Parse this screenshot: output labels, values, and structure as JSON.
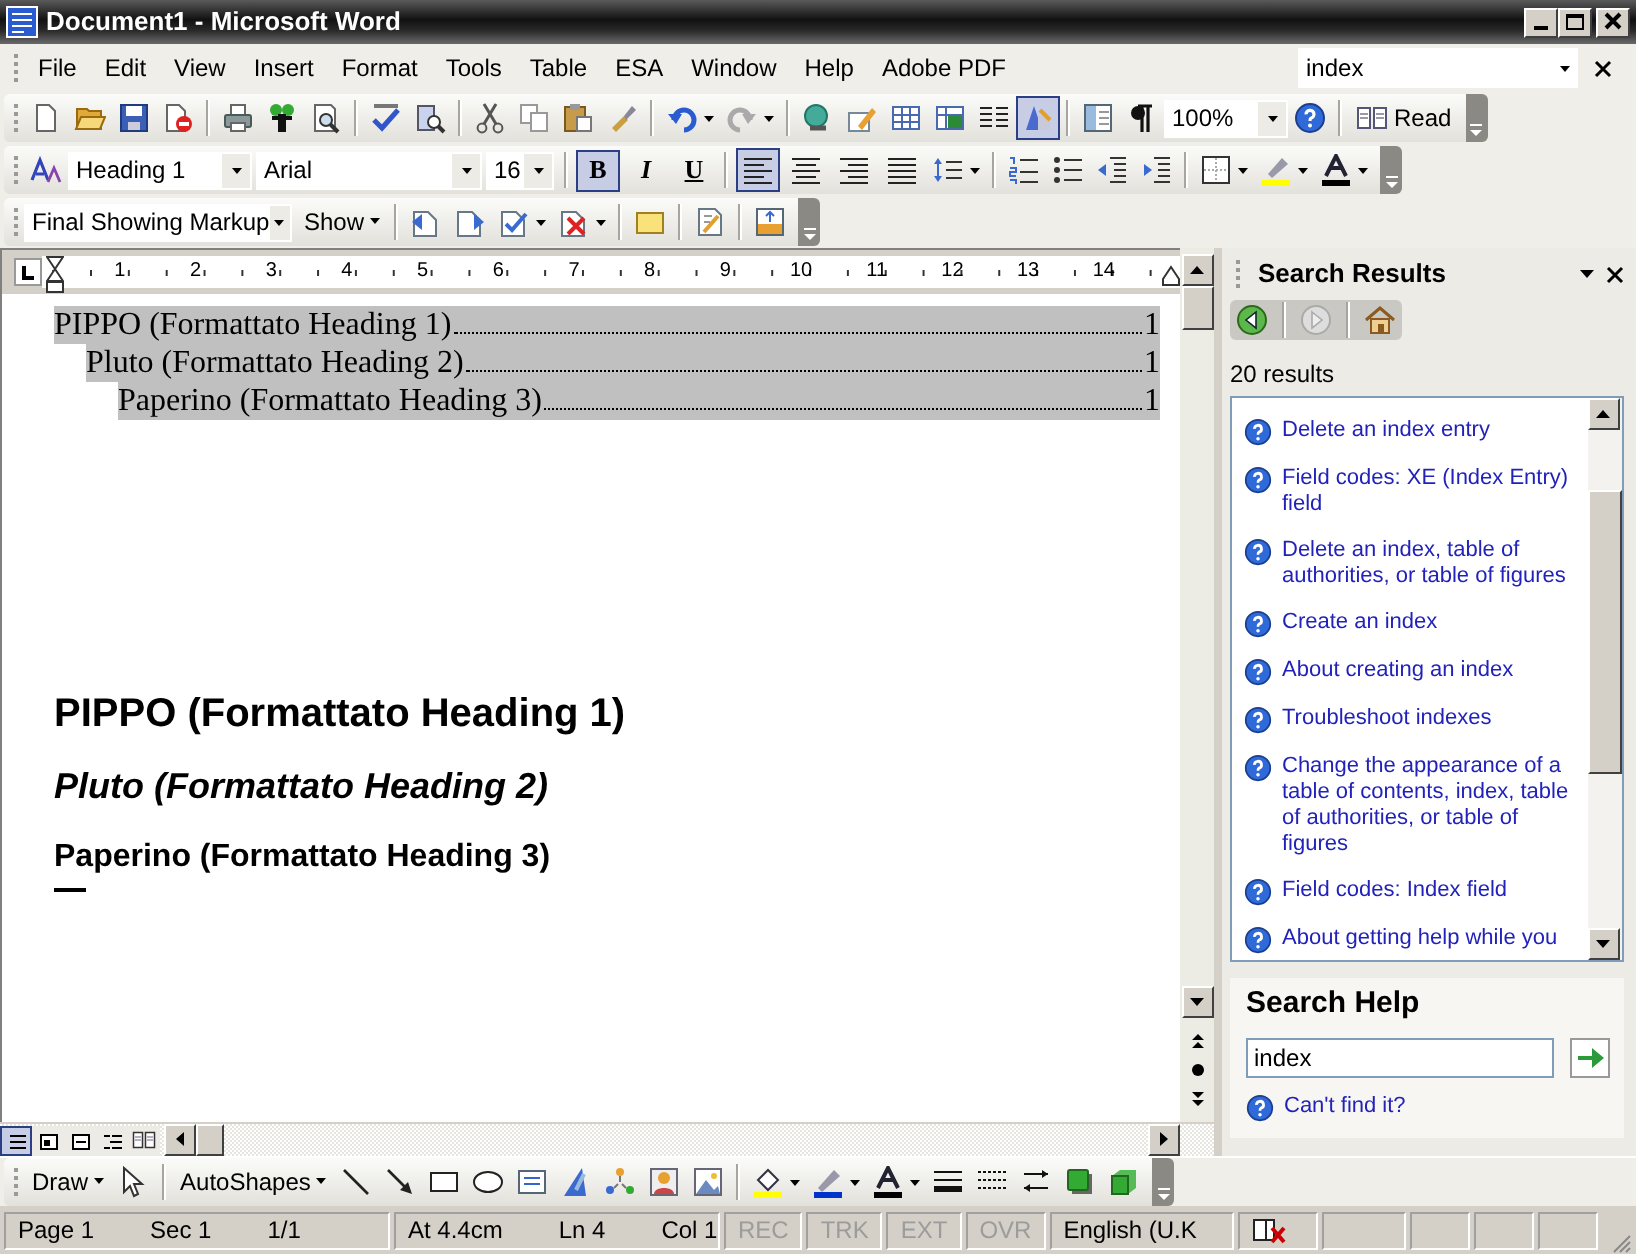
{
  "window": {
    "title": "Document1 - Microsoft Word"
  },
  "menu": [
    "File",
    "Edit",
    "View",
    "Insert",
    "Format",
    "Tools",
    "Table",
    "ESA",
    "Window",
    "Help",
    "Adobe PDF"
  ],
  "help_box": {
    "value": "index"
  },
  "standard_toolbar": {
    "drawing_pressed": true,
    "zoom": "100%",
    "read_label": "Read"
  },
  "formatting_toolbar": {
    "style": "Heading 1",
    "font": "Arial",
    "size": "16",
    "text_buttons": [
      {
        "label": "B",
        "kind": "bold",
        "pressed": true
      },
      {
        "label": "I",
        "kind": "italic",
        "pressed": false
      },
      {
        "label": "U",
        "kind": "underline",
        "pressed": false
      }
    ],
    "alignment": [
      {
        "kind": "left",
        "selected": true
      },
      {
        "kind": "center",
        "selected": false
      },
      {
        "kind": "right",
        "selected": false
      },
      {
        "kind": "justify",
        "selected": false
      }
    ]
  },
  "reviewing_toolbar": {
    "display": "Final Showing Markup",
    "show_label": "Show"
  },
  "ruler_labels": [
    "1",
    "2",
    "3",
    "4",
    "5",
    "6",
    "7",
    "8",
    "9",
    "10",
    "11",
    "12",
    "13",
    "14"
  ],
  "document": {
    "toc": [
      {
        "text": "PIPPO (Formattato Heading 1)",
        "page": "1",
        "children": [
          {
            "text": "Pluto (Formattato Heading 2)",
            "page": "1",
            "children": [
              {
                "text": "Paperino (Formattato Heading 3)",
                "page": "1"
              }
            ]
          }
        ]
      }
    ],
    "headings": [
      {
        "kind": "heading1",
        "text": "PIPPO (Formattato Heading 1)"
      },
      {
        "kind": "heading2",
        "text": "Pluto (Formattato Heading 2)"
      },
      {
        "kind": "heading3",
        "text": "Paperino (Formattato Heading 3)"
      }
    ]
  },
  "view_buttons": [
    {
      "kind": "normal",
      "selected": true
    },
    {
      "kind": "web",
      "selected": false
    },
    {
      "kind": "print",
      "selected": false
    },
    {
      "kind": "outline",
      "selected": false
    },
    {
      "kind": "reading",
      "selected": false
    }
  ],
  "task_pane": {
    "title": "Search Results",
    "results_count": "20 results",
    "results": [
      "Delete an index entry",
      "Field codes: XE (Index Entry) field",
      "Delete an index, table of authorities, or table of figures",
      "Create an index",
      "About creating an index",
      "Troubleshoot indexes",
      "Change the appearance of a table of contents, index, table of authorities, or table of figures",
      "Field codes: Index field",
      "About getting help while you"
    ],
    "search_help": {
      "title": "Search Help",
      "value": "index",
      "cant_find": "Can't find it?"
    }
  },
  "drawing_toolbar": {
    "draw_label": "Draw",
    "autoshapes_label": "AutoShapes"
  },
  "status_bar": [
    {
      "parts": [
        "Page 1",
        "Sec 1",
        "1/1"
      ],
      "disabled": false
    },
    {
      "parts": [
        "At 4.4cm",
        "Ln 4",
        "Col 1"
      ],
      "disabled": false
    },
    {
      "parts": [
        "REC"
      ],
      "disabled": true
    },
    {
      "parts": [
        "TRK"
      ],
      "disabled": true
    },
    {
      "parts": [
        "EXT"
      ],
      "disabled": true
    },
    {
      "parts": [
        "OVR"
      ],
      "disabled": true
    },
    {
      "parts": [
        "English (U.K"
      ],
      "disabled": false
    }
  ]
}
